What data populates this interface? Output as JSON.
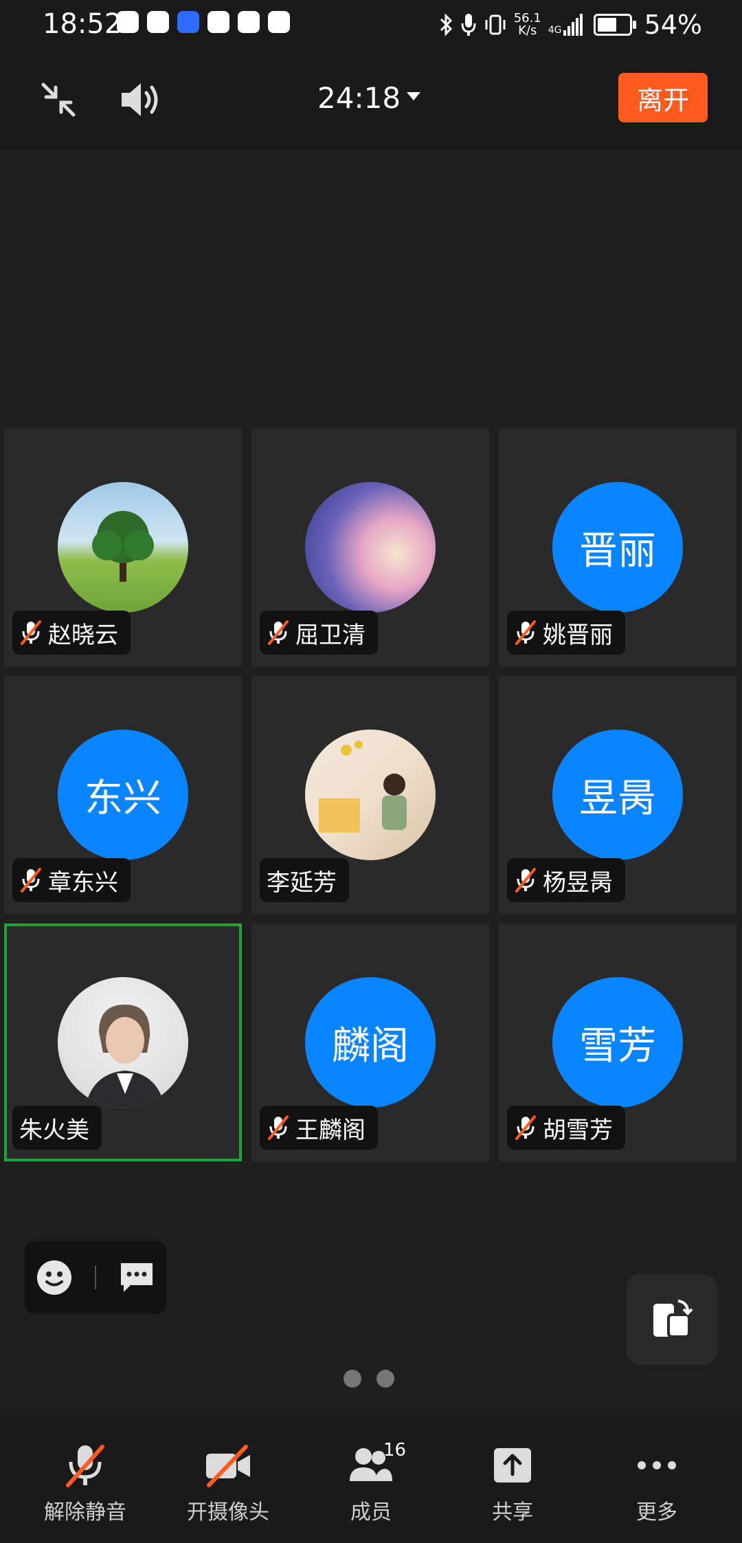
{
  "status_bar": {
    "time": "18:52",
    "net_speed_value": "56.1",
    "net_speed_unit": "K/s",
    "net_type": "4G",
    "battery": "54%"
  },
  "meeting": {
    "timer": "24:18",
    "leave_label": "离开"
  },
  "participants": [
    {
      "name": "赵晓云",
      "avatar_text": "",
      "avatar_kind": "tree-photo",
      "muted": true
    },
    {
      "name": "屈卫清",
      "avatar_text": "",
      "avatar_kind": "gradient-photo",
      "muted": true
    },
    {
      "name": "姚晋丽",
      "avatar_text": "晋丽",
      "avatar_kind": "initials",
      "muted": true
    },
    {
      "name": "章东兴",
      "avatar_text": "东兴",
      "avatar_kind": "initials",
      "muted": true
    },
    {
      "name": "李延芳",
      "avatar_text": "",
      "avatar_kind": "illustration-photo",
      "muted": false
    },
    {
      "name": "杨昱昺",
      "avatar_text": "昱昺",
      "avatar_kind": "initials",
      "muted": true
    },
    {
      "name": "朱火美",
      "avatar_text": "",
      "avatar_kind": "portrait-photo",
      "muted": false,
      "active_speaker": true
    },
    {
      "name": "王麟阁",
      "avatar_text": "麟阁",
      "avatar_kind": "initials",
      "muted": true
    },
    {
      "name": "胡雪芳",
      "avatar_text": "雪芳",
      "avatar_kind": "initials",
      "muted": true
    }
  ],
  "page_indicator": {
    "count": 2,
    "current": 1
  },
  "toolbar": {
    "unmute_label": "解除静音",
    "camera_label": "开摄像头",
    "members_label": "成员",
    "members_count": "16",
    "share_label": "共享",
    "more_label": "更多"
  },
  "colors": {
    "accent_blue": "#0B84FF",
    "leave_orange": "#FF5A1F",
    "active_green": "#1FA33A",
    "mute_red": "#FF5A1F"
  },
  "icons": [
    "minimize-icon",
    "speaker-icon",
    "emoji-icon",
    "chat-icon",
    "swap-screen-icon",
    "mic-off-icon",
    "camera-off-icon",
    "members-icon",
    "share-icon",
    "more-icon"
  ]
}
